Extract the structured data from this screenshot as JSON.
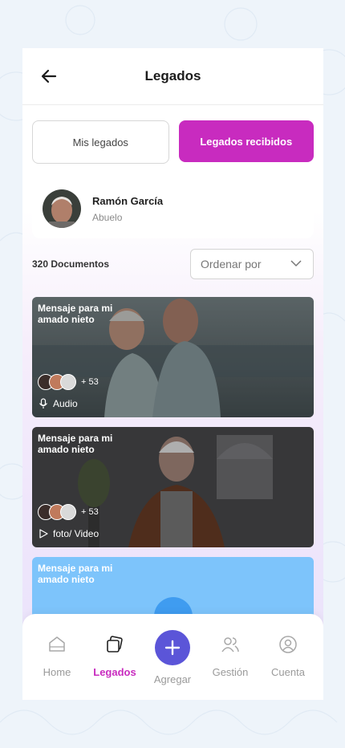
{
  "header": {
    "title": "Legados"
  },
  "tabs": [
    {
      "label": "Mis legados",
      "active": false
    },
    {
      "label": "Legados recibidos",
      "active": true
    }
  ],
  "profile": {
    "name": "Ramón García",
    "role": "Abuelo"
  },
  "documents": {
    "count_label": "320 Documentos",
    "sort_placeholder": "Ordenar por"
  },
  "cards": [
    {
      "title": "Mensaje para mi amado nieto",
      "extra_count": "+ 53",
      "type": "Audio",
      "type_icon": "microphone-icon"
    },
    {
      "title": "Mensaje para mi amado nieto",
      "extra_count": "+ 53",
      "type": "foto/ Video",
      "type_icon": "play-icon"
    },
    {
      "title": "Mensaje para mi amado nieto"
    }
  ],
  "nav": [
    {
      "label": "Home",
      "icon": "home-icon"
    },
    {
      "label": "Legados",
      "icon": "legacy-cards-icon",
      "active": true
    },
    {
      "label": "Agregar",
      "icon": "plus-icon"
    },
    {
      "label": "Gestión",
      "icon": "people-icon"
    },
    {
      "label": "Cuenta",
      "icon": "account-icon"
    }
  ],
  "colors": {
    "accent": "#c82bbf",
    "add_button": "#5b55d8",
    "card3": "#7dc4fb"
  }
}
